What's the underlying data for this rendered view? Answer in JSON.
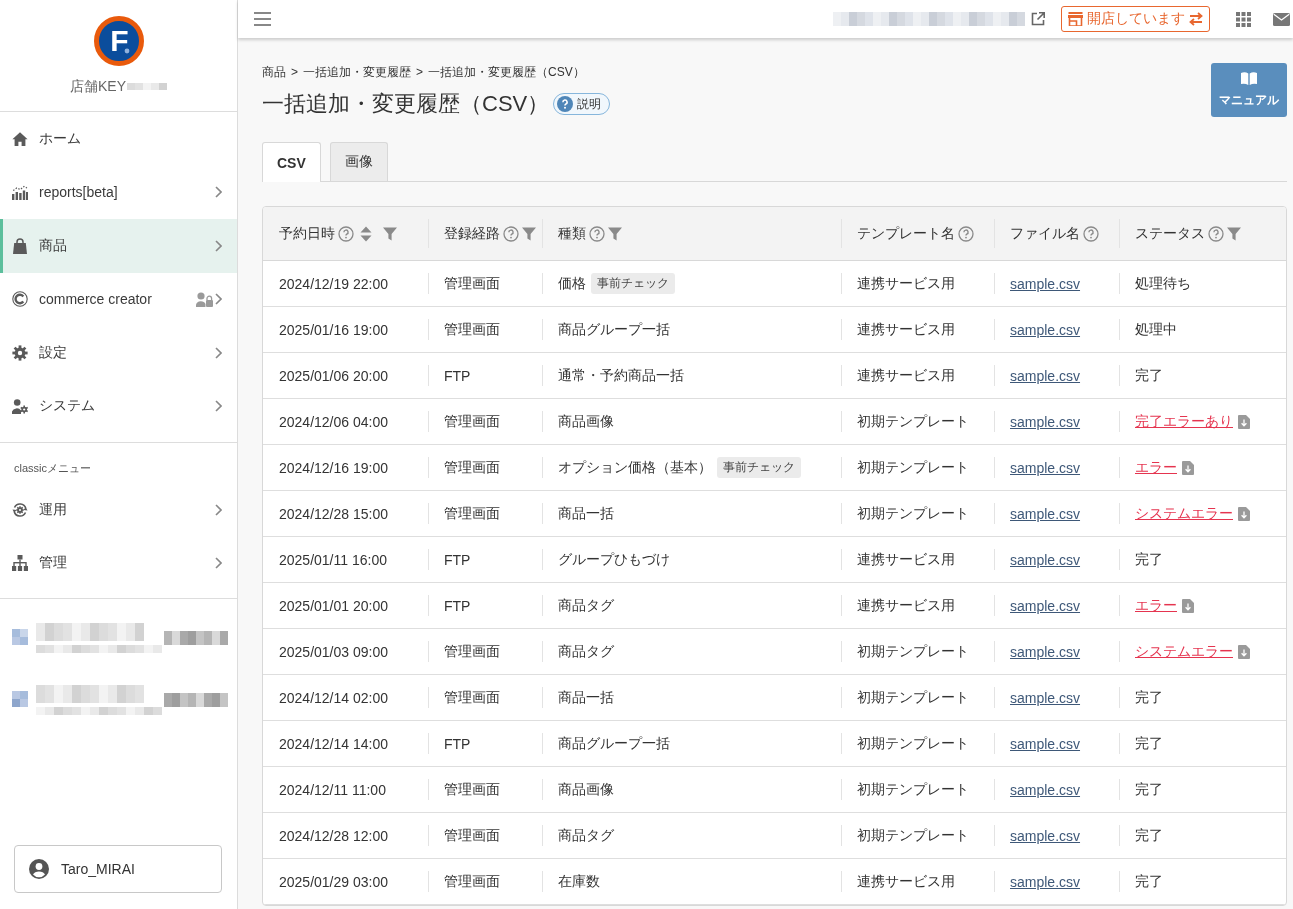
{
  "sidebar": {
    "logo": {
      "mark": "F"
    },
    "store_key": {
      "label": "店舗KEY",
      "value": {
        "kind": "redacted"
      }
    },
    "nav": [
      {
        "label": "ホーム",
        "selected": false,
        "submenu": false,
        "locked": false
      },
      {
        "label": "reports[beta]",
        "selected": false,
        "submenu": true,
        "locked": false
      },
      {
        "label": "商品",
        "selected": true,
        "submenu": true,
        "locked": false
      },
      {
        "label": "commerce creator",
        "selected": false,
        "submenu": true,
        "locked": true
      },
      {
        "label": "設定",
        "selected": false,
        "submenu": true,
        "locked": false
      },
      {
        "label": "システム",
        "selected": false,
        "submenu": true,
        "locked": false
      }
    ],
    "classic_menu": {
      "heading": "classicメニュー",
      "items": [
        {
          "label": "運用",
          "selected": false,
          "submenu": true,
          "locked": false
        },
        {
          "label": "管理",
          "selected": false,
          "submenu": true,
          "locked": false
        }
      ]
    },
    "shops": [
      {
        "kind": "redacted"
      },
      {
        "kind": "redacted"
      }
    ],
    "user": {
      "name": "Taro_MIRAI"
    }
  },
  "topbar": {
    "site_link": {
      "kind": "redacted"
    },
    "store_status_button": {
      "label": "開店しています"
    }
  },
  "page": {
    "breadcrumb": [
      {
        "label": "商品",
        "separator": ">"
      },
      {
        "label": "一括追加・変更履歴",
        "separator": ">"
      },
      {
        "label": "一括追加・変更履歴（CSV）"
      }
    ],
    "title": "一括追加・変更履歴（CSV）",
    "help_badge": {
      "label": "説明"
    },
    "manual_button": {
      "label": "マニュアル"
    }
  },
  "tabs": [
    {
      "label": "CSV",
      "selected": true
    },
    {
      "label": "画像",
      "selected": false
    }
  ],
  "table": {
    "columns": [
      {
        "label": "予約日時",
        "help": true,
        "sortable": true,
        "filterable": true
      },
      {
        "label": "登録経路",
        "help": true,
        "sortable": false,
        "filterable": true
      },
      {
        "label": "種類",
        "help": true,
        "sortable": false,
        "filterable": true
      },
      {
        "label": "テンプレート名",
        "help": true,
        "sortable": false,
        "filterable": false
      },
      {
        "label": "ファイル名",
        "help": true,
        "sortable": false,
        "filterable": false
      },
      {
        "label": "ステータス",
        "help": true,
        "sortable": false,
        "filterable": true
      }
    ],
    "rows": [
      {
        "scheduled_at": "2024/12/19 22:00",
        "route": "管理画面",
        "type": "価格",
        "type_badge": "事前チェック",
        "template": "連携サービス用",
        "file": "sample.csv",
        "status": "処理待ち",
        "status_error": false
      },
      {
        "scheduled_at": "2025/01/16 19:00",
        "route": "管理画面",
        "type": "商品グループ一括",
        "template": "連携サービス用",
        "file": "sample.csv",
        "status": "処理中",
        "status_error": false
      },
      {
        "scheduled_at": "2025/01/06 20:00",
        "route": "FTP",
        "type": "通常・予約商品一括",
        "template": "連携サービス用",
        "file": "sample.csv",
        "status": "完了",
        "status_error": false
      },
      {
        "scheduled_at": "2024/12/06 04:00",
        "route": "管理画面",
        "type": "商品画像",
        "template": "初期テンプレート",
        "file": "sample.csv",
        "status": "完了エラーあり",
        "status_error": true
      },
      {
        "scheduled_at": "2024/12/16 19:00",
        "route": "管理画面",
        "type": "オプション価格（基本）",
        "type_badge": "事前チェック",
        "template": "初期テンプレート",
        "file": "sample.csv",
        "status": "エラー",
        "status_error": true
      },
      {
        "scheduled_at": "2024/12/28 15:00",
        "route": "管理画面",
        "type": "商品一括",
        "template": "初期テンプレート",
        "file": "sample.csv",
        "status": "システムエラー",
        "status_error": true
      },
      {
        "scheduled_at": "2025/01/11 16:00",
        "route": "FTP",
        "type": "グループひもづけ",
        "template": "連携サービス用",
        "file": "sample.csv",
        "status": "完了",
        "status_error": false
      },
      {
        "scheduled_at": "2025/01/01 20:00",
        "route": "FTP",
        "type": "商品タグ",
        "template": "連携サービス用",
        "file": "sample.csv",
        "status": "エラー",
        "status_error": true
      },
      {
        "scheduled_at": "2025/01/03 09:00",
        "route": "管理画面",
        "type": "商品タグ",
        "template": "初期テンプレート",
        "file": "sample.csv",
        "status": "システムエラー",
        "status_error": true
      },
      {
        "scheduled_at": "2024/12/14 02:00",
        "route": "管理画面",
        "type": "商品一括",
        "template": "初期テンプレート",
        "file": "sample.csv",
        "status": "完了",
        "status_error": false
      },
      {
        "scheduled_at": "2024/12/14 14:00",
        "route": "FTP",
        "type": "商品グループ一括",
        "template": "初期テンプレート",
        "file": "sample.csv",
        "status": "完了",
        "status_error": false
      },
      {
        "scheduled_at": "2024/12/11 11:00",
        "route": "管理画面",
        "type": "商品画像",
        "template": "初期テンプレート",
        "file": "sample.csv",
        "status": "完了",
        "status_error": false
      },
      {
        "scheduled_at": "2024/12/28 12:00",
        "route": "管理画面",
        "type": "商品タグ",
        "template": "初期テンプレート",
        "file": "sample.csv",
        "status": "完了",
        "status_error": false
      },
      {
        "scheduled_at": "2025/01/29 03:00",
        "route": "管理画面",
        "type": "在庫数",
        "template": "連携サービス用",
        "file": "sample.csv",
        "status": "完了",
        "status_error": false
      }
    ]
  }
}
